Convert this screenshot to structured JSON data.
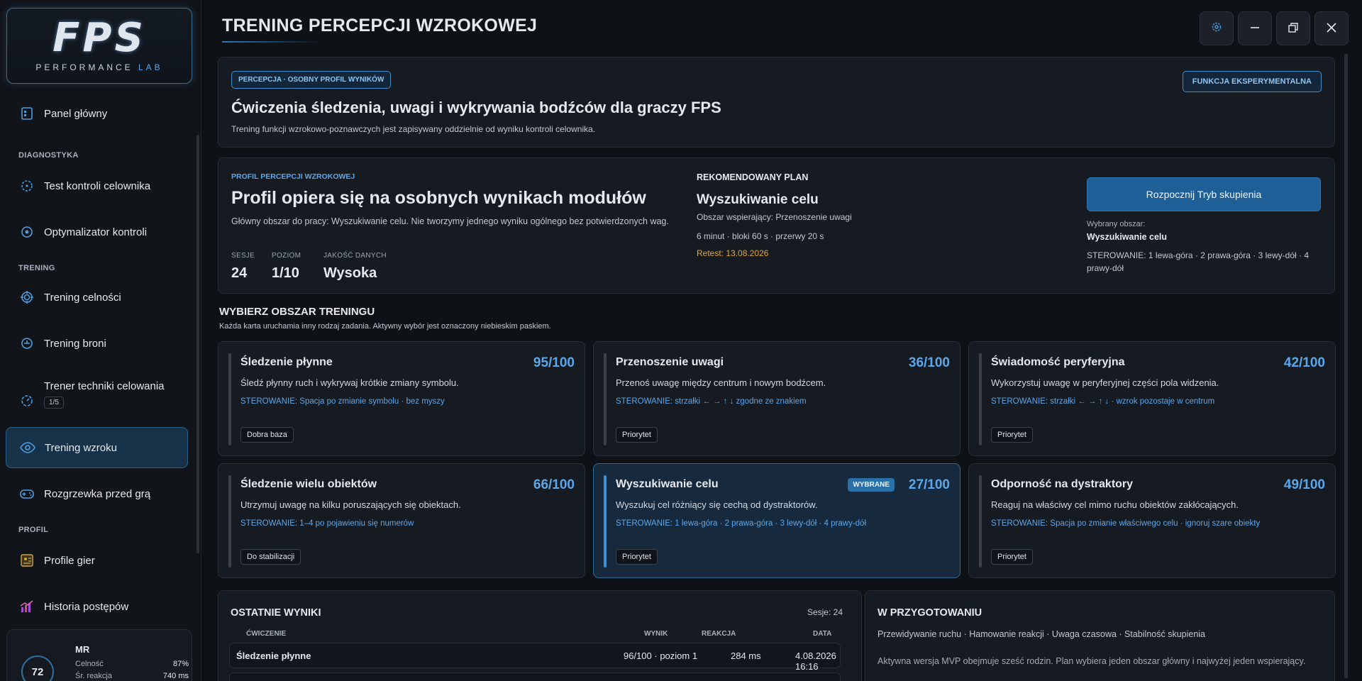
{
  "logo": {
    "main": "FPS",
    "sub_a": "PERFORMANCE",
    "sub_b": "LAB"
  },
  "sidebar": {
    "items": [
      {
        "label": "Panel główny"
      },
      {
        "label": "Test kontroli celownika"
      },
      {
        "label": "Optymalizator kontroli"
      },
      {
        "label": "Trening celności"
      },
      {
        "label": "Trening broni"
      },
      {
        "label": "Trener techniki celowania",
        "badge": "1/5"
      },
      {
        "label": "Trening wzroku"
      },
      {
        "label": "Rozgrzewka przed grą"
      },
      {
        "label": "Profile gier"
      },
      {
        "label": "Historia postępów"
      }
    ],
    "sections": {
      "diag": "DIAGNOSTYKA",
      "train": "TRENING",
      "profile": "PROFIL"
    }
  },
  "user": {
    "initials": "MR",
    "score": "72",
    "accuracy_label": "Celność",
    "accuracy": "87%",
    "reaction_label": "Śr. reakcja",
    "reaction": "740 ms"
  },
  "header": {
    "title": "TRENING PERCEPCJI WZROKOWEJ"
  },
  "hero": {
    "tag": "PERCEPCJA · OSOBNY PROFIL WYNIKÓW",
    "experimental": "FUNKCJA EKSPERYMENTALNA",
    "title": "Ćwiczenia śledzenia, uwagi i wykrywania bodźców dla graczy FPS",
    "desc": "Trening funkcji wzrokowo-poznawczych jest zapisywany oddzielnie od wyniku kontroli celownika."
  },
  "profile": {
    "cap": "PROFIL PERCEPCJI WZROKOWEJ",
    "title": "Profil opiera się na osobnych wynikach modułów",
    "desc": "Główny obszar do pracy: Wyszukiwanie celu. Nie tworzymy jednego wyniku ogólnego bez potwierdzonych wag.",
    "stats": [
      {
        "label": "SESJE",
        "value": "24"
      },
      {
        "label": "POZIOM",
        "value": "1/10"
      },
      {
        "label": "JAKOŚĆ DANYCH",
        "value": "Wysoka"
      }
    ]
  },
  "plan": {
    "cap": "REKOMENDOWANY PLAN",
    "title": "Wyszukiwanie celu",
    "support": "Obszar wspierający: Przenoszenie uwagi",
    "timing": "6 minut · bloki 60 s · przerwy 20 s",
    "retest": "Retest: 13.08.2026"
  },
  "focus": {
    "button": "Rozpocznij Tryb skupienia",
    "selected_label": "Wybrany obszar:",
    "selected_value": "Wyszukiwanie celu",
    "controls": "STEROWANIE: 1 lewa-góra · 2 prawa-góra · 3 lewy-dół · 4 prawy-dół"
  },
  "areas": {
    "title": "WYBIERZ OBSZAR TRENINGU",
    "subtitle": "Każda karta uruchamia inny rodzaj zadania. Aktywny wybór jest oznaczony niebieskim paskiem.",
    "selected_badge": "WYBRANE",
    "cards": [
      {
        "title": "Śledzenie płynne",
        "score": "95/100",
        "desc": "Śledź płynny ruch i wykrywaj krótkie zmiany symbolu.",
        "controls": "STEROWANIE: Spacja po zmianie symbolu · bez myszy",
        "chip": "Dobra baza"
      },
      {
        "title": "Przenoszenie uwagi",
        "score": "36/100",
        "desc": "Przenoś uwagę między centrum i nowym bodźcem.",
        "controls": "STEROWANIE: strzałki ← → ↑ ↓ zgodne ze znakiem",
        "chip": "Priorytet"
      },
      {
        "title": "Świadomość peryferyjna",
        "score": "42/100",
        "desc": "Wykorzystuj uwagę w peryferyjnej części pola widzenia.",
        "controls": "STEROWANIE: strzałki ← → ↑ ↓ · wzrok pozostaje w centrum",
        "chip": "Priorytet"
      },
      {
        "title": "Śledzenie wielu obiektów",
        "score": "66/100",
        "desc": "Utrzymuj uwagę na kilku poruszających się obiektach.",
        "controls": "STEROWANIE: 1–4 po pojawieniu się numerów",
        "chip": "Do stabilizacji"
      },
      {
        "title": "Wyszukiwanie celu",
        "score": "27/100",
        "desc": "Wyszukuj cel różniący się cechą od dystraktorów.",
        "controls": "STEROWANIE: 1 lewa-góra · 2 prawa-góra · 3 lewy-dół · 4 prawy-dół",
        "chip": "Priorytet"
      },
      {
        "title": "Odporność na dystraktory",
        "score": "49/100",
        "desc": "Reaguj na właściwy cel mimo ruchu obiektów zakłócających.",
        "controls": "STEROWANIE: Spacja po zmianie właściwego celu · ignoruj szare obiekty",
        "chip": "Priorytet"
      }
    ]
  },
  "results": {
    "title": "OSTATNIE WYNIKI",
    "sessions": "Sesje: 24",
    "columns": [
      "ĆWICZENIE",
      "WYNIK",
      "REAKCJA",
      "DATA"
    ],
    "rows": [
      {
        "exercise": "Śledzenie płynne",
        "result": "96/100 · poziom 1",
        "reaction": "284 ms",
        "date": "4.08.2026 16:16"
      }
    ]
  },
  "upcoming": {
    "title": "W PRZYGOTOWANIU",
    "list": "Przewidywanie ruchu · Hamowanie reakcji · Uwaga czasowa · Stabilność skupienia",
    "note": "Aktywna wersja MVP obejmuje sześć rodzin. Plan wybiera jeden obszar główny i najwyżej jeden wspierający."
  }
}
